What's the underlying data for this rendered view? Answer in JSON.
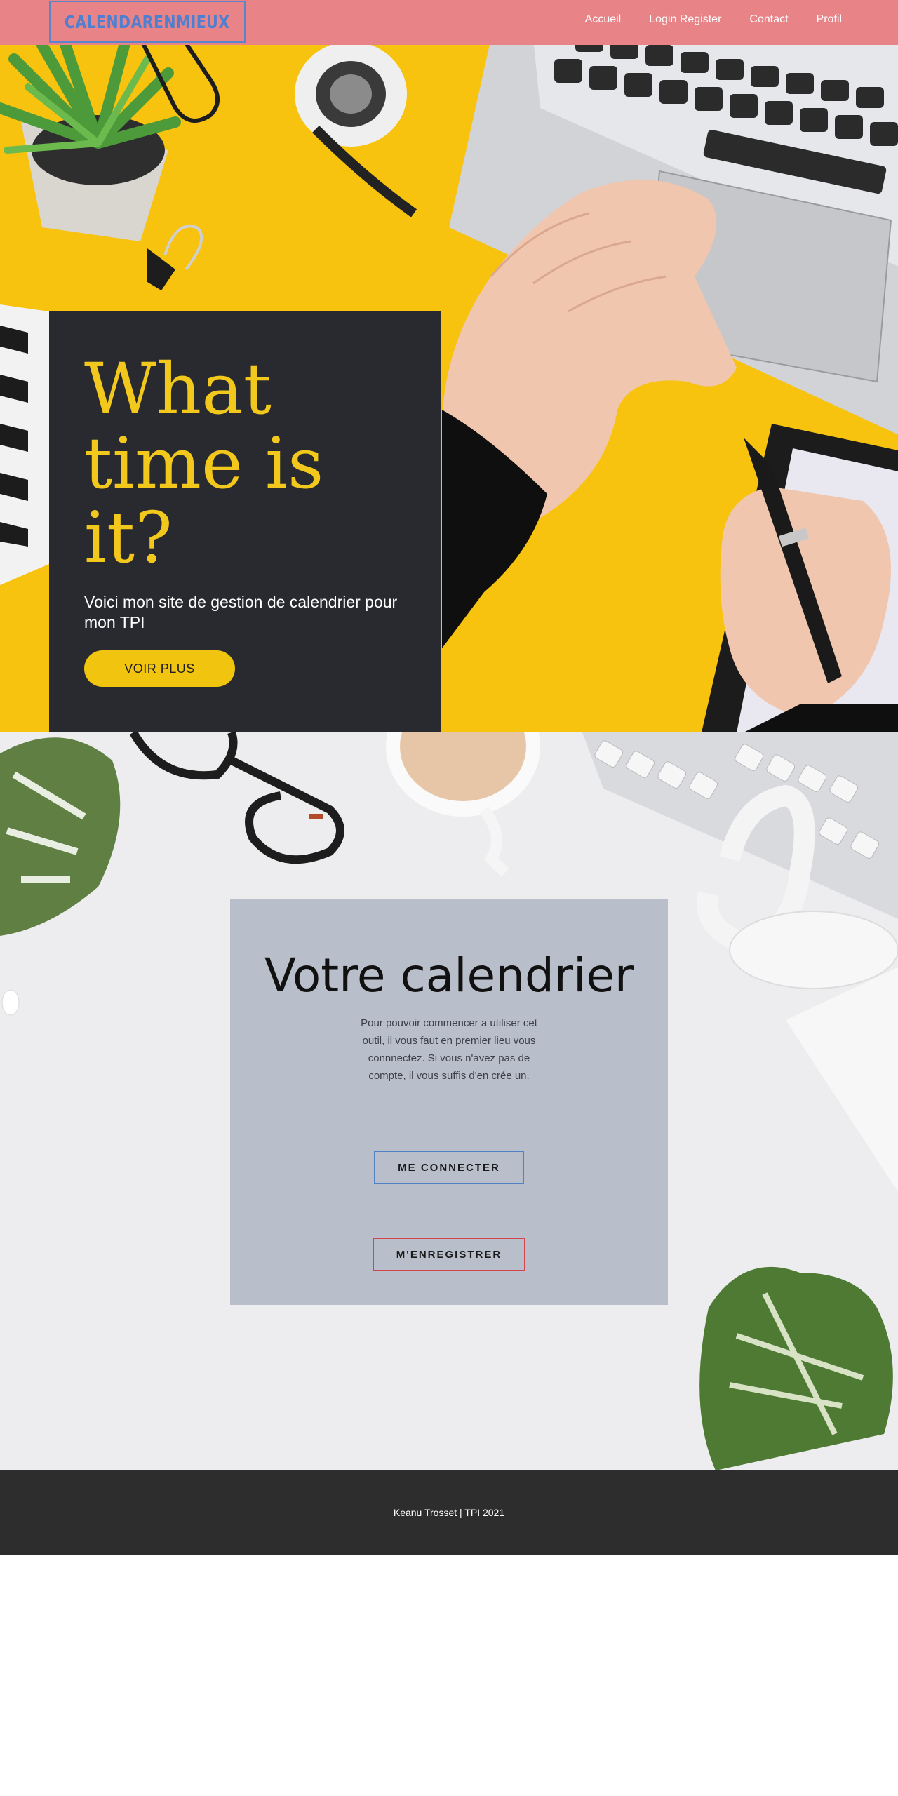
{
  "navbar": {
    "logo": "CALENDARENMIEUX",
    "links": [
      "Accueil",
      "Login Register",
      "Contact",
      "Profil"
    ]
  },
  "hero": {
    "title": "What time is it?",
    "subtitle": "Voici mon site de gestion de calendrier pour mon TPI",
    "button": "VOIR PLUS"
  },
  "calendar": {
    "title": "Votre calendrier",
    "description": "Pour pouvoir commencer a utiliser cet outil, il vous faut en premier lieu vous connnectez. Si vous n'avez pas de compte, il vous suffis d'en crée un.",
    "connect_button": "ME CONNECTER",
    "register_button": "M'ENREGISTRER"
  },
  "footer": {
    "text": "Keanu Trosset | TPI 2021"
  },
  "colors": {
    "navbar": "#e88387",
    "logo": "#4e7fd0",
    "hero_background": "#f7c30e",
    "hero_card": "#282a30",
    "hero_title": "#f1c81b",
    "hero_button": "#f1c40f",
    "calendar_card": "#b9bfca",
    "connect_border": "#4f82c8",
    "register_border": "#d2464c",
    "footer": "#2d2d2d"
  },
  "icons": [
    "hero-photo-desk-laptop",
    "calendar-photo-desk-keyboard"
  ]
}
